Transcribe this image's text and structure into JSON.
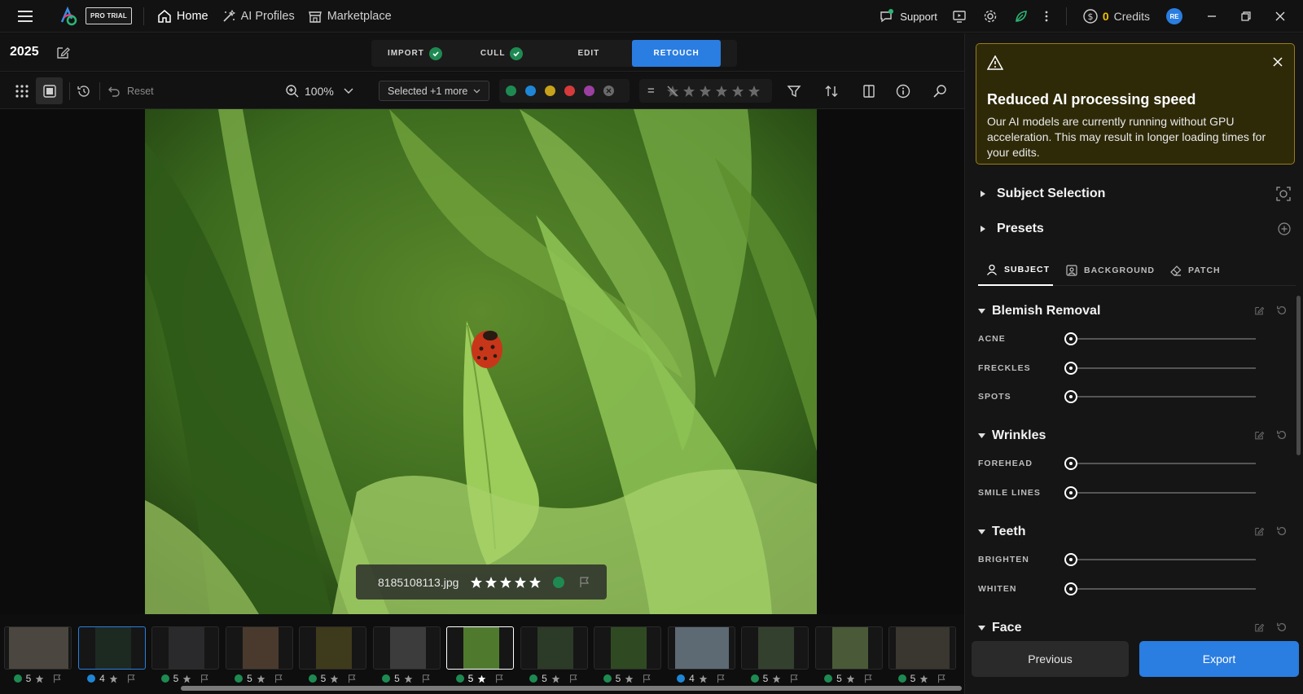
{
  "app": {
    "badge": "PRO TRIAL",
    "nav": [
      {
        "label": "Home",
        "icon": "home-icon"
      },
      {
        "label": "AI Profiles",
        "icon": "wand-icon"
      },
      {
        "label": "Marketplace",
        "icon": "store-icon"
      }
    ],
    "support": "Support",
    "credits_value": "0",
    "credits_label": "Credits",
    "avatar": "RE"
  },
  "project": {
    "title": "2025"
  },
  "steps": [
    {
      "label": "IMPORT",
      "done": true
    },
    {
      "label": "CULL",
      "done": true
    },
    {
      "label": "EDIT",
      "done": false
    },
    {
      "label": "RETOUCH",
      "active": true
    }
  ],
  "toolbar": {
    "reset": "Reset",
    "zoom": "100%",
    "selected": "Selected +1 more",
    "color_labels": [
      "#1e8a52",
      "#1f86d6",
      "#c7a21a",
      "#d63a3a",
      "#9b3fa0"
    ],
    "equals": "="
  },
  "photo": {
    "filename": "8185108113.jpg",
    "rating": 5
  },
  "filmstrip": [
    {
      "rating": "5",
      "color": "#1e8a52",
      "bg": "#4b4740"
    },
    {
      "rating": "4",
      "color": "#1f86d6",
      "bg": "#1d2a22",
      "selected": true
    },
    {
      "rating": "5",
      "color": "#1e8a52",
      "bg": "#2a2a2c"
    },
    {
      "rating": "5",
      "color": "#1e8a52",
      "bg": "#4a3a2e"
    },
    {
      "rating": "5",
      "color": "#1e8a52",
      "bg": "#3e3a1c"
    },
    {
      "rating": "5",
      "color": "#1e8a52",
      "bg": "#3c3c3c"
    },
    {
      "rating": "5",
      "color": "#1e8a52",
      "bg": "#4f7a2e",
      "current": true
    },
    {
      "rating": "5",
      "color": "#1e8a52",
      "bg": "#2c3a28"
    },
    {
      "rating": "5",
      "color": "#1e8a52",
      "bg": "#2f4a22"
    },
    {
      "rating": "4",
      "color": "#1f86d6",
      "bg": "#5d6a74"
    },
    {
      "rating": "5",
      "color": "#1e8a52",
      "bg": "#34402e"
    },
    {
      "rating": "5",
      "color": "#1e8a52",
      "bg": "#4a5a38"
    },
    {
      "rating": "5",
      "color": "#1e8a52",
      "bg": "#3a3630"
    }
  ],
  "alert": {
    "title": "Reduced AI processing speed",
    "message": "Our AI models are currently running without GPU acceleration. This may result in longer loading times for your edits."
  },
  "panel": {
    "subject_selection": "Subject Selection",
    "presets": "Presets",
    "tabs": [
      {
        "label": "SUBJECT",
        "icon": "person-icon"
      },
      {
        "label": "BACKGROUND",
        "icon": "portrait-icon"
      },
      {
        "label": "PATCH",
        "icon": "eraser-icon"
      }
    ],
    "groups": [
      {
        "title": "Blemish Removal",
        "sliders": [
          "ACNE",
          "FRECKLES",
          "SPOTS"
        ]
      },
      {
        "title": "Wrinkles",
        "sliders": [
          "FOREHEAD",
          "SMILE LINES"
        ]
      },
      {
        "title": "Teeth",
        "sliders": [
          "BRIGHTEN",
          "WHITEN"
        ]
      },
      {
        "title": "Face",
        "sliders": []
      }
    ]
  },
  "footer": {
    "previous": "Previous",
    "export": "Export"
  }
}
